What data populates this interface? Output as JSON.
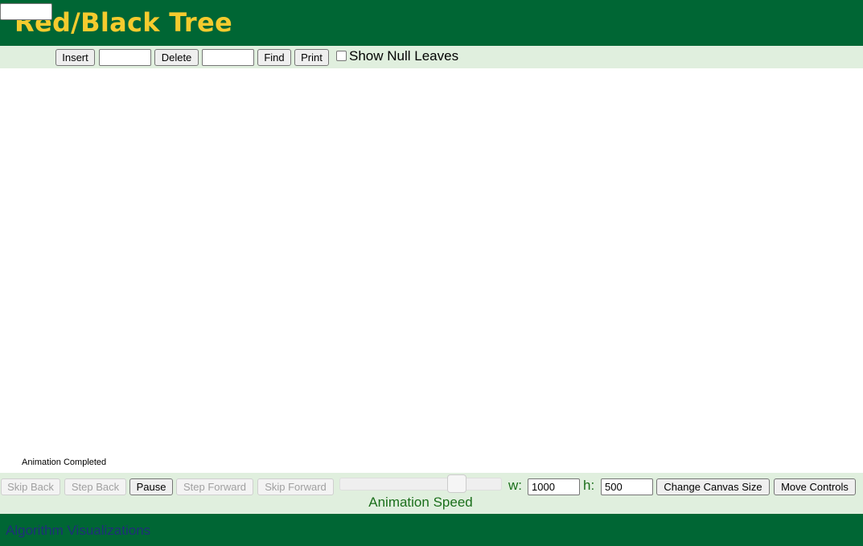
{
  "header": {
    "title": "Red/Black Tree"
  },
  "toolbar": {
    "insert_label": "Insert",
    "delete_label": "Delete",
    "find_label": "Find",
    "print_label": "Print",
    "show_null_leaves_label": "Show Null Leaves",
    "show_null_leaves_checked": false
  },
  "canvas": {
    "status": "Animation Completed"
  },
  "controls": {
    "skip_back": "Skip Back",
    "step_back": "Step Back",
    "pause": "Pause",
    "step_forward": "Step Forward",
    "skip_forward": "Skip Forward",
    "speed_label": "Animation Speed",
    "speed_value": 0.75,
    "w_label": "w:",
    "w_value": "1000",
    "h_label": "h:",
    "h_value": "500",
    "change_canvas_size": "Change Canvas Size",
    "move_controls": "Move Controls"
  },
  "footer": {
    "link": "Algorithm Visualizations"
  },
  "colors": {
    "header_bg": "#006634",
    "title": "#f5cb2e",
    "bar_bg": "#e0efde",
    "label_green": "#1b6f1b"
  }
}
